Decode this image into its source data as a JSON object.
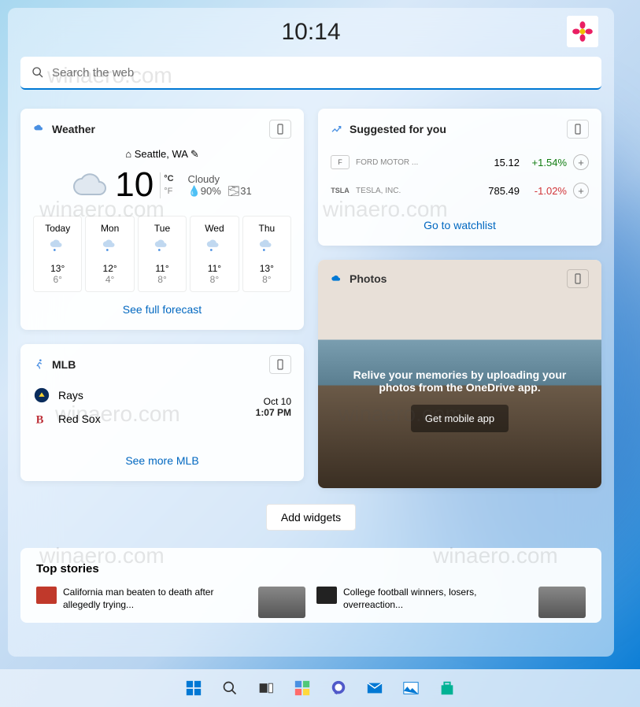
{
  "clock": "10:14",
  "search": {
    "placeholder": "Search the web"
  },
  "weather": {
    "title": "Weather",
    "location": "Seattle, WA",
    "temp": "10",
    "unit_c": "°C",
    "unit_f": "°F",
    "condition": "Cloudy",
    "humidity": "90%",
    "extra": "31",
    "forecast": [
      {
        "day": "Today",
        "hi": "13°",
        "lo": "6°"
      },
      {
        "day": "Mon",
        "hi": "12°",
        "lo": "4°"
      },
      {
        "day": "Tue",
        "hi": "11°",
        "lo": "8°"
      },
      {
        "day": "Wed",
        "hi": "11°",
        "lo": "8°"
      },
      {
        "day": "Thu",
        "hi": "13°",
        "lo": "8°"
      }
    ],
    "link": "See full forecast"
  },
  "stocks": {
    "title": "Suggested for you",
    "rows": [
      {
        "sym": "F",
        "name": "FORD MOTOR ...",
        "price": "15.12",
        "change": "+1.54%",
        "dir": "up"
      },
      {
        "sym": "TSLA",
        "name": "TESLA, INC.",
        "price": "785.49",
        "change": "-1.02%",
        "dir": "down"
      }
    ],
    "link": "Go to watchlist"
  },
  "mlb": {
    "title": "MLB",
    "teams": [
      {
        "name": "Rays"
      },
      {
        "name": "Red Sox"
      }
    ],
    "date": "Oct 10",
    "time": "1:07 PM",
    "link": "See more MLB"
  },
  "photos": {
    "title": "Photos",
    "text": "Relive your memories by uploading your photos from the OneDrive app.",
    "button": "Get mobile app"
  },
  "add_widgets": "Add widgets",
  "top_stories": {
    "title": "Top stories",
    "items": [
      {
        "headline": "California man beaten to death after allegedly trying..."
      },
      {
        "headline": "College football winners, losers, overreaction..."
      }
    ]
  },
  "watermark": "winaero.com"
}
